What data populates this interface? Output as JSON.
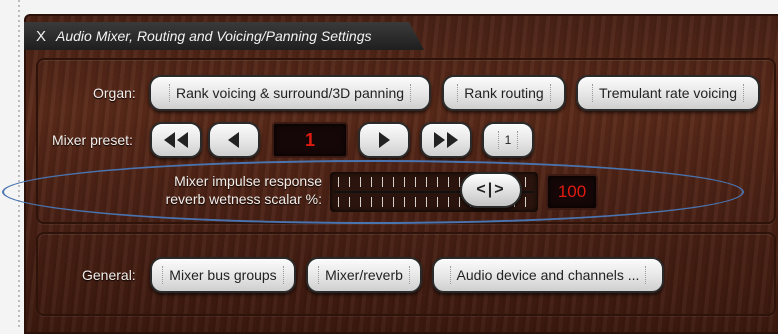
{
  "title": {
    "close_symbol": "X",
    "text": "Audio Mixer, Routing and Voicing/Panning Settings"
  },
  "organ": {
    "label": "Organ:",
    "buttons": [
      "Rank voicing & surround/3D panning",
      "Rank routing",
      "Tremulant rate voicing"
    ]
  },
  "mixer_preset": {
    "label": "Mixer preset:",
    "value": "1",
    "step_value": "1",
    "icons": [
      "fast-rewind-icon",
      "previous-icon",
      "next-icon",
      "fast-forward-icon"
    ]
  },
  "reverb": {
    "label_line1": "Mixer impulse response",
    "label_line2": "reverb wetness scalar %:",
    "value": "100",
    "knob_symbol": "<|>",
    "level_percent": 100
  },
  "general": {
    "label": "General:",
    "buttons": [
      "Mixer bus groups",
      "Mixer/reverb",
      "Audio device and channels ..."
    ]
  },
  "colors": {
    "display_text": "#e11a10",
    "highlight": "#4a74b0"
  }
}
